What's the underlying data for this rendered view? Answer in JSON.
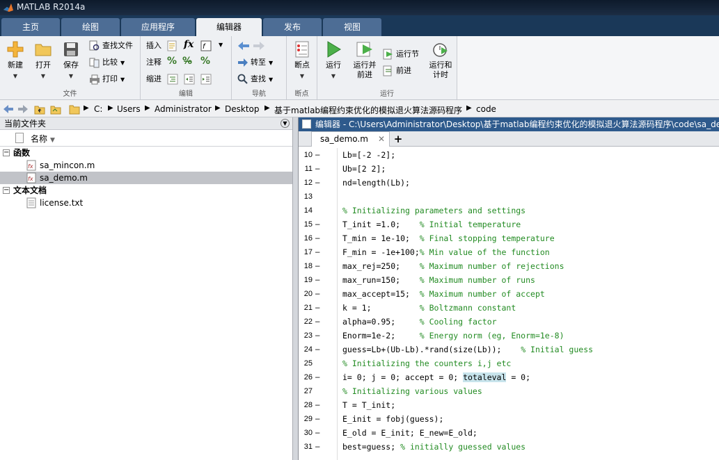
{
  "window": {
    "title": "MATLAB R2014a"
  },
  "tabs": [
    "主页",
    "绘图",
    "应用程序",
    "编辑器",
    "发布",
    "视图"
  ],
  "ribbon": {
    "file": {
      "label": "文件",
      "new": "新建",
      "open": "打开",
      "save": "保存",
      "find_files": "查找文件",
      "compare": "比较",
      "print": "打印"
    },
    "edit": {
      "label": "编辑",
      "insert": "插入",
      "comment": "注释",
      "indent": "缩进"
    },
    "navigate": {
      "label": "导航",
      "goto": "转至",
      "find": "查找"
    },
    "breakpoints": {
      "label": "断点",
      "breakpoints": "断点"
    },
    "run": {
      "label": "运行",
      "run": "运行",
      "run_advance_1": "运行并",
      "run_advance_2": "前进",
      "run_section": "运行节",
      "advance": "前进",
      "run_time_1": "运行和",
      "run_time_2": "计时"
    }
  },
  "address": {
    "parts": [
      "C:",
      "Users",
      "Administrator",
      "Desktop",
      "基于matlab编程约束优化的模拟退火算法源码程序",
      "code"
    ]
  },
  "file_browser": {
    "title": "当前文件夹",
    "column_name": "名称",
    "functions_label": "函数",
    "functions": [
      "sa_mincon.m",
      "sa_demo.m"
    ],
    "text_docs_label": "文本文档",
    "text_docs": [
      "license.txt"
    ]
  },
  "editor": {
    "title": "编辑器 - C:\\Users\\Administrator\\Desktop\\基于matlab编程约束优化的模拟退火算法源码程序\\code\\sa_demo.m",
    "tab": "sa_demo.m",
    "lines": [
      {
        "n": "10",
        "dash": "–",
        "code": "Lb=[-2 -2];",
        "comment": ""
      },
      {
        "n": "11",
        "dash": "–",
        "code": "Ub=[2 2];",
        "comment": ""
      },
      {
        "n": "12",
        "dash": "–",
        "code": "nd=length(Lb);",
        "comment": ""
      },
      {
        "n": "13",
        "dash": "",
        "code": "",
        "comment": ""
      },
      {
        "n": "14",
        "dash": "",
        "code": "",
        "comment": "% Initializing parameters and settings"
      },
      {
        "n": "15",
        "dash": "–",
        "code": "T_init =1.0;    ",
        "comment": "% Initial temperature"
      },
      {
        "n": "16",
        "dash": "–",
        "code": "T_min = 1e-10;  ",
        "comment": "% Final stopping temperature"
      },
      {
        "n": "17",
        "dash": "–",
        "code": "F_min = -1e+100;",
        "comment": "% Min value of the function"
      },
      {
        "n": "18",
        "dash": "–",
        "code": "max_rej=250;    ",
        "comment": "% Maximum number of rejections"
      },
      {
        "n": "19",
        "dash": "–",
        "code": "max_run=150;    ",
        "comment": "% Maximum number of runs"
      },
      {
        "n": "20",
        "dash": "–",
        "code": "max_accept=15;  ",
        "comment": "% Maximum number of accept"
      },
      {
        "n": "21",
        "dash": "–",
        "code": "k = 1;          ",
        "comment": "% Boltzmann constant"
      },
      {
        "n": "22",
        "dash": "–",
        "code": "alpha=0.95;     ",
        "comment": "% Cooling factor"
      },
      {
        "n": "23",
        "dash": "–",
        "code": "Enorm=1e-2;     ",
        "comment": "% Energy norm (eg, Enorm=1e-8)"
      },
      {
        "n": "24",
        "dash": "–",
        "code": "guess=Lb+(Ub-Lb).*rand(size(Lb));    ",
        "comment": "% Initial guess"
      },
      {
        "n": "25",
        "dash": "",
        "code": "",
        "comment": "% Initializing the counters i,j etc"
      },
      {
        "n": "26",
        "dash": "–",
        "code": "i= 0; j = 0; accept = 0; ",
        "hl": "totaleval",
        "after": " = 0;",
        "comment": ""
      },
      {
        "n": "27",
        "dash": "",
        "code": "",
        "comment": "% Initializing various values"
      },
      {
        "n": "28",
        "dash": "–",
        "code": "T = T_init;",
        "comment": ""
      },
      {
        "n": "29",
        "dash": "–",
        "code": "E_init = fobj(guess);",
        "comment": ""
      },
      {
        "n": "30",
        "dash": "–",
        "code": "E_old = E_init; E_new=E_old;",
        "comment": ""
      },
      {
        "n": "31",
        "dash": "–",
        "code": "best=guess; ",
        "comment": "% initially guessed values"
      }
    ]
  },
  "colors": {
    "tabbar": "#1a3858",
    "tab": "#4d6d95",
    "editor_title": "#2e5a8c",
    "comment": "#228b22",
    "highlight": "#c8e4ec"
  }
}
